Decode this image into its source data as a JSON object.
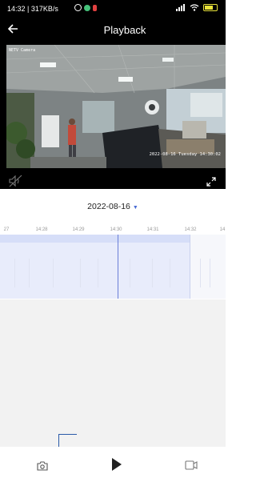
{
  "status_bar": {
    "time_network": "14:32 | 317KB/s",
    "icons": [
      "alarm-icon",
      "wechat-icon",
      "notification-icon",
      "signal-icon",
      "wifi-icon",
      "battery-icon"
    ],
    "battery_color": "#e8e23a"
  },
  "header": {
    "back_icon": "arrow-left-icon",
    "title": "Playback"
  },
  "video": {
    "camera_name": "NETV Camera",
    "timestamp": "2022-08-16 Tuesday 14:30:02",
    "mute_icon": "speaker-muted-icon",
    "fullscreen_icon": "expand-icon"
  },
  "date_picker": {
    "date": "2022-08-16",
    "caret": "▼",
    "caret_color": "#4a6cd4"
  },
  "timeline": {
    "ticks": [
      "27",
      "14:28",
      "14:29",
      "14:30",
      "14:31",
      "14:32",
      "14"
    ],
    "recorded_color": "#e8ecfb",
    "cursor_color": "#6a7fd8"
  },
  "controls": {
    "snapshot_icon": "camera-icon",
    "play_icon": "play-icon",
    "record_icon": "video-record-icon"
  }
}
